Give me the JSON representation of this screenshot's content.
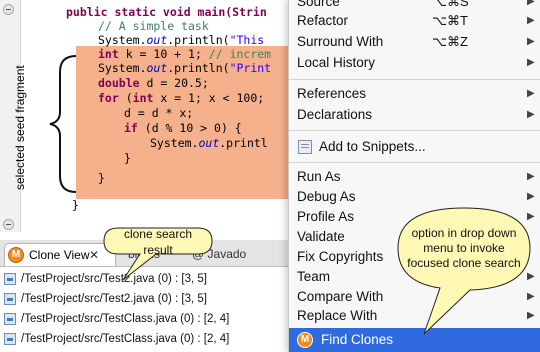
{
  "editor": {
    "line1": "public static void main(Strin",
    "line2": "// A simple task",
    "line3_a": "System.",
    "line3_b": "out",
    "line3_c": ".println(",
    "line3_d": "\"This",
    "line4_a": "int",
    "line4_b": " k = 10 + 1; ",
    "line4_c": "// increm",
    "line5_a": "System.",
    "line5_b": "out",
    "line5_c": ".println(",
    "line5_d": "\"Print",
    "line6_a": "double",
    "line6_b": " d = 20.5;",
    "line7_a": "for",
    "line7_b": " (",
    "line7_c": "int",
    "line7_d": " x = 1; x < 100;",
    "line8": "d = d * x;",
    "line9_a": "if",
    "line9_b": " (d % 10 > 0) {",
    "line10_a": "System.",
    "line10_b": "out",
    "line10_c": ".printl",
    "line11": "}",
    "line12": "}",
    "line13": "}",
    "vertical_label": "selected seed fragment",
    "highlight_color": "#f5b08c"
  },
  "bottom": {
    "tab_clone": "Clone View",
    "tab_close": "✕",
    "tab_problems": "blems",
    "tab_javadoc": "@ Javado",
    "results": [
      "/TestProject/src/Test2.java (0) : [3, 5]",
      "/TestProject/src/Test2.java (0) : [3, 5]",
      "/TestProject/src/TestClass.java (0) : [2, 4]",
      "/TestProject/src/TestClass.java (0) : [2, 4]"
    ]
  },
  "menu": {
    "source": "Source",
    "source_sc": "⌥⌘S",
    "refactor": "Refactor",
    "refactor_sc": "⌥⌘T",
    "surround": "Surround With",
    "surround_sc": "⌥⌘Z",
    "history": "Local History",
    "references": "References",
    "declarations": "Declarations",
    "snippets": "Add to Snippets...",
    "runas": "Run As",
    "debugas": "Debug As",
    "profileas": "Profile As",
    "validate": "Validate",
    "copyrights": "Fix Copyrights",
    "team": "Team",
    "compare": "Compare With",
    "replace": "Replace With",
    "find": "Find Clones",
    "arrow": "▶",
    "highlight_color": "#2f6bdf"
  },
  "callouts": {
    "clone_search": "clone search result",
    "option_menu": "option in drop down menu to invoke focused clone search",
    "bubble_color": "#fff9b5"
  }
}
